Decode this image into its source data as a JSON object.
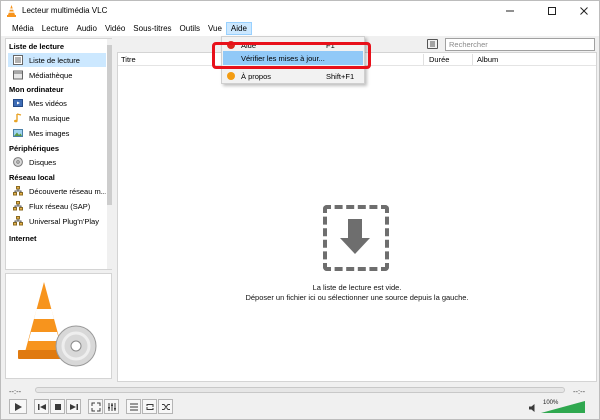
{
  "window": {
    "title": "Lecteur multimédia VLC"
  },
  "menubar": {
    "items": [
      "Média",
      "Lecture",
      "Audio",
      "Vidéo",
      "Sous-titres",
      "Outils",
      "Vue",
      "Aide"
    ],
    "active": "Aide"
  },
  "sidebar": {
    "cat_playlist": "Liste de lecture",
    "item_playlist": "Liste de lecture",
    "item_media_library": "Médiathèque",
    "cat_my_computer": "Mon ordinateur",
    "item_videos": "Mes vidéos",
    "item_music": "Ma musique",
    "item_images": "Mes images",
    "cat_devices": "Périphériques",
    "item_disks": "Disques",
    "cat_local_network": "Réseau local",
    "item_network_discovery": "Découverte réseau m...",
    "item_sap": "Flux réseau (SAP)",
    "item_upnp": "Universal Plug'n'Play",
    "cat_internet": "Internet"
  },
  "search": {
    "placeholder": "Rechercher"
  },
  "playlist": {
    "col_title": "Titre",
    "col_duration": "Durée",
    "col_album": "Album",
    "empty_line1": "La liste de lecture est vide.",
    "empty_line2": "Déposer un fichier ici ou sélectionner une source depuis la gauche."
  },
  "help_menu": {
    "help_label": "Aide",
    "help_shortcut": "F1",
    "check_updates_label": "Vérifier les mises à jour...",
    "about_label": "À propos",
    "about_shortcut": "Shift+F1"
  },
  "controls": {
    "time_elapsed": "--:--",
    "time_total": "--:--",
    "volume": "100%"
  },
  "colors": {
    "accent_orange": "#f7941d",
    "selection": "#cce8ff",
    "menu_hover": "#91c9f7",
    "highlight_red": "#e8101a",
    "volume_green": "#2fa84f"
  }
}
